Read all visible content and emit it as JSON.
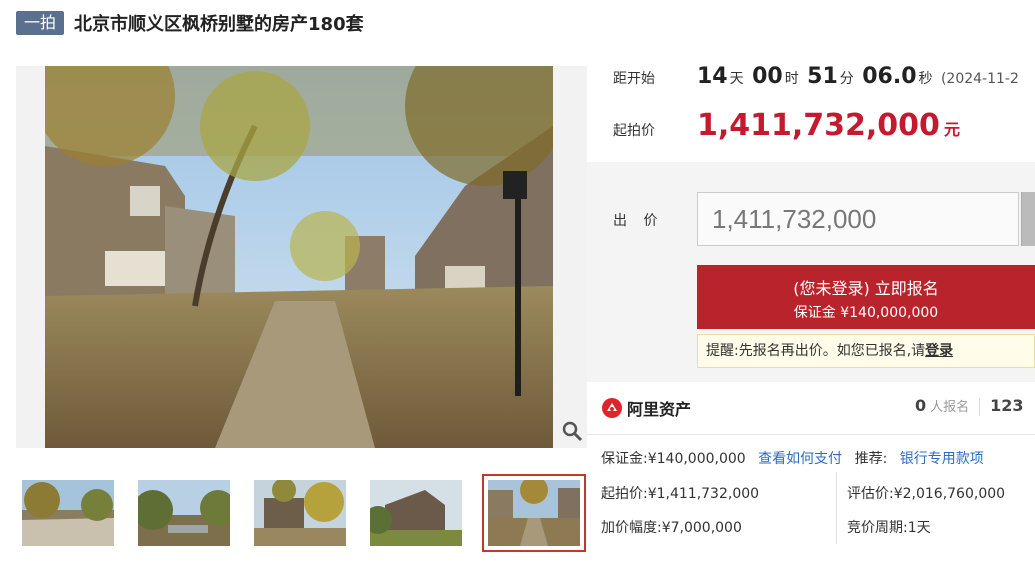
{
  "header": {
    "badge": "一拍",
    "title": "北京市顺义区枫桥别墅的房产180套"
  },
  "countdown": {
    "label": "距开始",
    "days": "14",
    "days_unit": "天",
    "hours": "00",
    "hours_unit": "时",
    "minutes": "51",
    "minutes_unit": "分",
    "seconds": "06.0",
    "seconds_unit": "秒",
    "date_prefix": "(2024-11-2"
  },
  "start_price": {
    "label": "起拍价",
    "value": "1,411,732,000",
    "unit": "元"
  },
  "bid": {
    "label": "出 价",
    "input_value": "1,411,732,000",
    "button_line1": "(您未登录) 立即报名",
    "button_line2": "保证金 ¥140,000,000",
    "reminder_text": "提醒:先报名再出价。如您已报名,请",
    "reminder_login": "登录"
  },
  "alibaba": {
    "brand": "阿里资产",
    "registrants": "0",
    "registrants_label": "人报名",
    "views": "123"
  },
  "details": {
    "deposit_label": "保证金:¥140,000,000",
    "how_to_pay": "查看如何支付",
    "recommend_label": "推荐:",
    "bank_loan": "银行专用款项",
    "start_price_label": "起拍价:¥1,411,732,000",
    "valuation_label": "评估价:¥2,016,760,000",
    "increment_label": "加价幅度:¥7,000,000",
    "cycle_label": "竞价周期:1天"
  },
  "colors": {
    "accent_red": "#c4192f",
    "button_red": "#b8232c",
    "link_blue": "#2d6cc0",
    "badge_bg": "#5b6f8f"
  },
  "icons": {
    "zoom": "magnifier-icon",
    "brand": "alibaba-logo-icon"
  }
}
